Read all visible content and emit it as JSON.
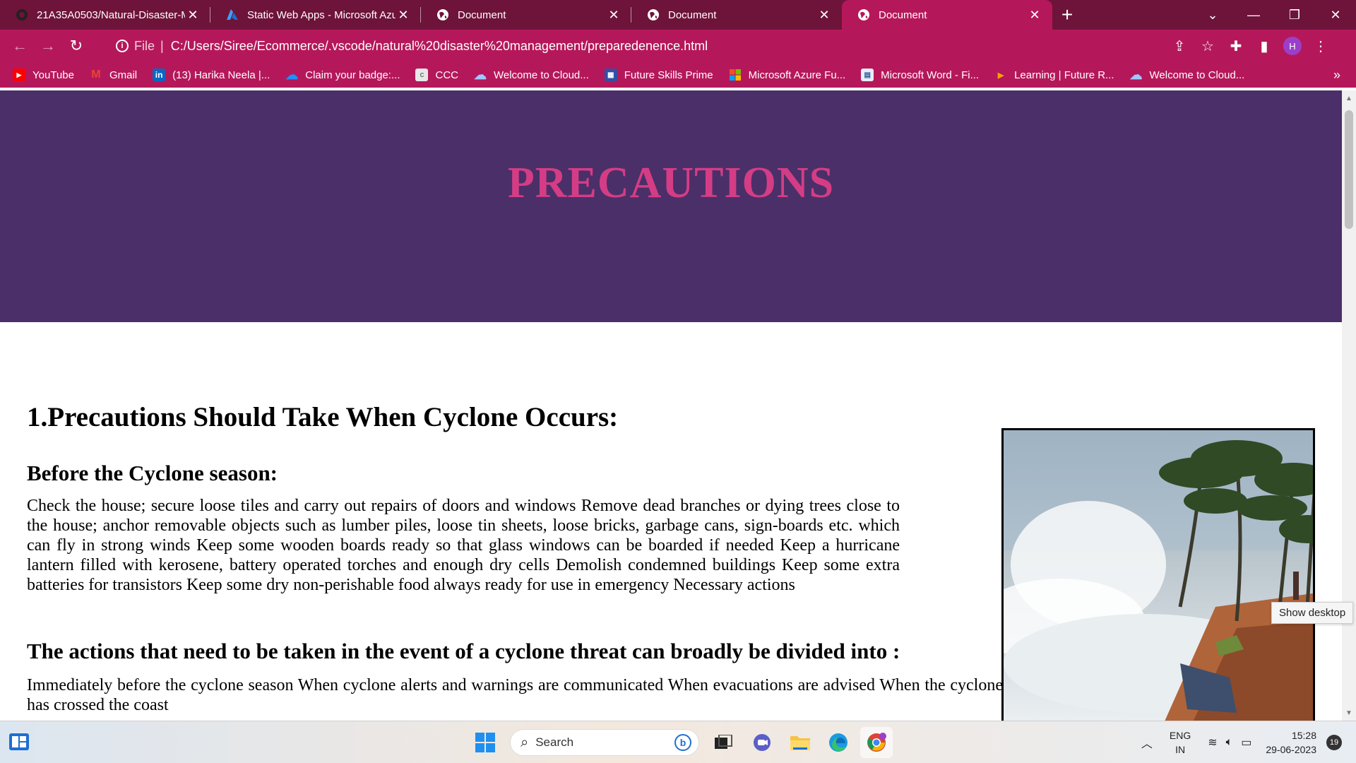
{
  "browser": {
    "tabs": [
      {
        "title": "21A35A0503/Natural-Disaster-M",
        "icon": "github-icon",
        "active": false
      },
      {
        "title": "Static Web Apps - Microsoft Azur",
        "icon": "azure-icon",
        "active": false
      },
      {
        "title": "Document",
        "icon": "globe-icon",
        "active": false
      },
      {
        "title": "Document",
        "icon": "globe-icon",
        "active": false
      },
      {
        "title": "Document",
        "icon": "globe-icon",
        "active": true
      }
    ],
    "address": {
      "scheme": "File",
      "url": "C:/Users/Siree/Ecommerce/.vscode/natural%20disaster%20management/preparedenence.html"
    },
    "profile_initial": "H",
    "bookmarks": [
      {
        "label": "YouTube",
        "icon": "youtube-icon",
        "color": "#ff0000"
      },
      {
        "label": "Gmail",
        "icon": "gmail-icon",
        "color": "#ea4335"
      },
      {
        "label": "(13) Harika Neela |...",
        "icon": "linkedin-icon",
        "color": "#0a66c2"
      },
      {
        "label": "Claim your badge:...",
        "icon": "cloud-icon",
        "color": "#1e90ff"
      },
      {
        "label": "CCC",
        "icon": "ccc-icon",
        "color": "#cccccc"
      },
      {
        "label": "Welcome to Cloud...",
        "icon": "cloud-outline-icon",
        "color": "#9ec9ff"
      },
      {
        "label": "Future Skills Prime",
        "icon": "calendar-icon",
        "color": "#2f4fa8"
      },
      {
        "label": "Microsoft Azure Fu...",
        "icon": "microsoft-icon",
        "color": "#f25022"
      },
      {
        "label": "Microsoft Word - Fi...",
        "icon": "document-icon",
        "color": "#e8eef8"
      },
      {
        "label": "Learning | Future R...",
        "icon": "play-icon",
        "color": "#f7a400"
      },
      {
        "label": "Welcome to Cloud...",
        "icon": "cloud-outline-icon",
        "color": "#9ec9ff"
      }
    ]
  },
  "page": {
    "hero_title": "PRECAUTIONS",
    "section1_heading": "1.Precautions Should Take When Cyclone Occurs:",
    "sub1_heading": "Before the Cyclone season:",
    "sub1_text": "Check the house; secure loose tiles and carry out repairs of doors and windows Remove dead branches or dying trees close to the house; anchor removable objects such as lumber piles, loose tin sheets, loose bricks, garbage cans, sign-boards etc. which can fly in strong winds Keep some wooden boards ready so that glass windows can be boarded if needed Keep a hurricane lantern filled with kerosene, battery operated torches and enough dry cells Demolish condemned buildings Keep some extra batteries for transistors Keep some dry non-perishable food always ready for use in emergency Necessary actions",
    "sub2_heading": "The actions that need to be taken in the event of a cyclone threat can broadly be divided into :",
    "sub2_text": "Immediately before the cyclone season When cyclone alerts and warnings are communicated When evacuations are advised When the cyclone has crossed the coast",
    "tooltip": "Show desktop"
  },
  "taskbar": {
    "search_label": "Search",
    "language": "ENG",
    "region": "IN",
    "time": "15:28",
    "date": "29-06-2023",
    "notifications": "19"
  },
  "colors": {
    "tab_strip": "#6e1339",
    "toolbar": "#b5185a",
    "hero_bg": "#4b2f69",
    "hero_title": "#d43d85"
  }
}
